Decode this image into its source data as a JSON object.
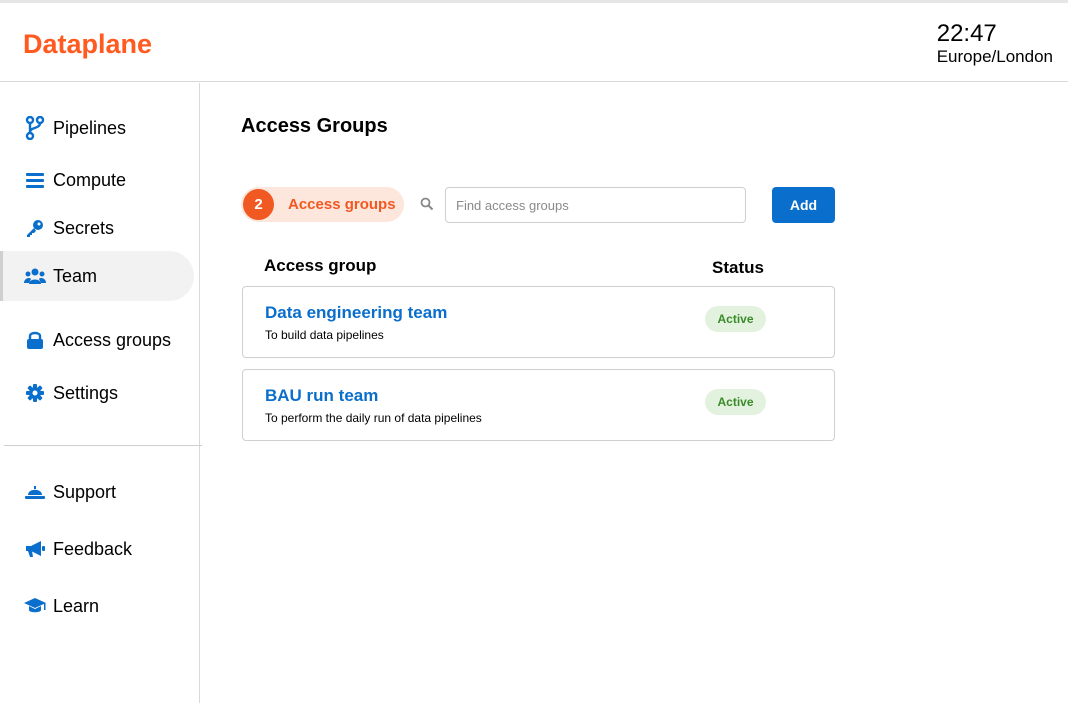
{
  "app": {
    "brand": "Dataplane",
    "clock_time": "22:47",
    "clock_timezone": "Europe/London",
    "brand_color": "#ff5a1f",
    "accent_color": "#0a6fcc"
  },
  "sidebar": {
    "items": [
      {
        "label": "Pipelines",
        "icon": "pipeline-branch-icon"
      },
      {
        "label": "Compute",
        "icon": "bars-icon"
      },
      {
        "label": "Secrets",
        "icon": "key-icon"
      },
      {
        "label": "Team",
        "icon": "users-icon",
        "active": true
      },
      {
        "label": "Access groups",
        "icon": "lock-icon"
      },
      {
        "label": "Settings",
        "icon": "gear-icon"
      }
    ],
    "support_items": [
      {
        "label": "Support",
        "icon": "bell-icon"
      },
      {
        "label": "Feedback",
        "icon": "megaphone-icon"
      },
      {
        "label": "Learn",
        "icon": "graduation-cap-icon"
      }
    ]
  },
  "main": {
    "title": "Access Groups",
    "count": "2",
    "count_label": "Access groups",
    "search_placeholder": "Find access groups",
    "add_label": "Add",
    "columns": {
      "group": "Access group",
      "status": "Status"
    },
    "rows": [
      {
        "title": "Data engineering team",
        "description": "To build data pipelines",
        "status": "Active"
      },
      {
        "title": "BAU run team",
        "description": "To perform the daily run of data pipelines",
        "status": "Active"
      }
    ]
  }
}
